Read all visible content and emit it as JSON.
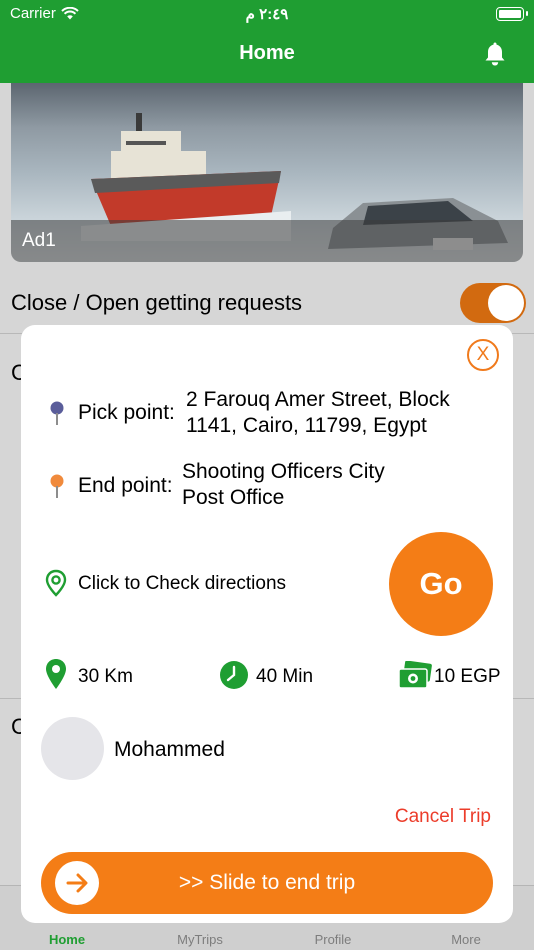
{
  "status_bar": {
    "carrier": "Carrier",
    "time": "٢:٤٩ م"
  },
  "nav": {
    "title": "Home"
  },
  "ad": {
    "label": "Ad1"
  },
  "requests": {
    "label": "Close / Open getting requests",
    "enabled": true
  },
  "background": {
    "letter_1": "C",
    "letter_2": "C"
  },
  "tabs": [
    {
      "label": "Home",
      "active": true
    },
    {
      "label": "MyTrips",
      "active": false
    },
    {
      "label": "Profile",
      "active": false
    },
    {
      "label": "More",
      "active": false
    }
  ],
  "trip": {
    "close_label": "X",
    "pick": {
      "label": "Pick point:",
      "line1": "2 Farouq Amer Street,  Block",
      "line2": "1141, Cairo, 11799, Egypt"
    },
    "end": {
      "label": "End point:",
      "line1": "Shooting Officers City",
      "line2": "Post Office"
    },
    "directions": "Click to Check directions",
    "go": "Go",
    "distance": "30 Km",
    "duration": "40 Min",
    "price": "10 EGP",
    "passenger": "Mohammed",
    "cancel": "Cancel Trip",
    "slide": ">> Slide to end trip"
  },
  "colors": {
    "green": "#1f9e32",
    "orange": "#f47d16",
    "red": "#ec3c2a"
  }
}
